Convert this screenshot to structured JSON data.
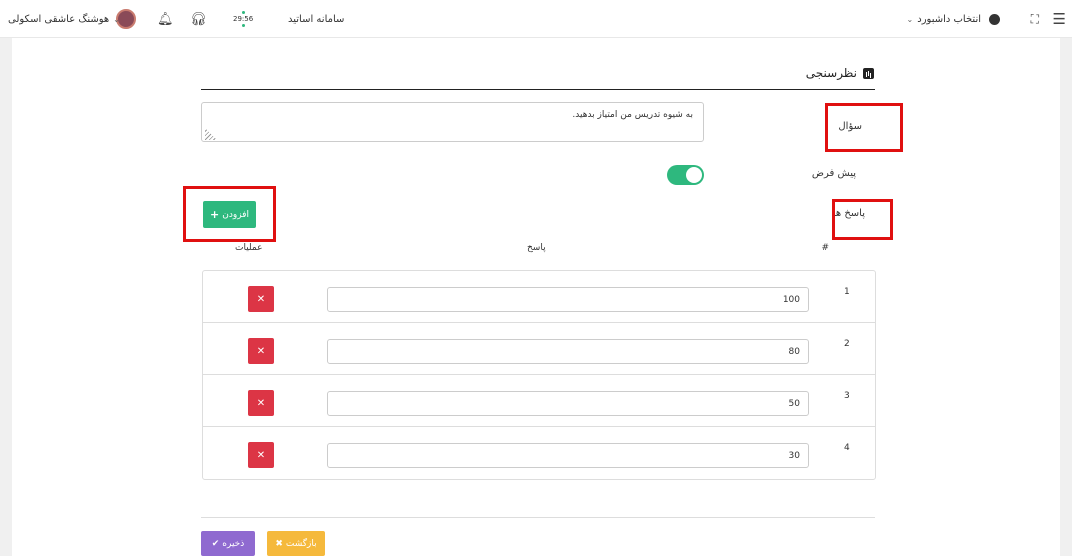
{
  "topbar": {
    "menu_icon": "menu-icon",
    "fullscreen_icon": "fullscreen-icon",
    "dashboard_select": "انتخاب داشبورد",
    "system_title": "سامانه اساتید",
    "clock_time": "29:56",
    "user_name": "هوشنگ عاشقی اسکولی"
  },
  "section": {
    "title": "نظرسنجی"
  },
  "form": {
    "question_label": "سؤال",
    "question_value": "به شیوه تدریس من امتیاز بدهید.",
    "default_label": "پیش فرض",
    "default_on": true,
    "answers_label": "پاسخ ها",
    "add_button": "افزودن"
  },
  "table": {
    "columns": {
      "num": "#",
      "answer": "پاسخ",
      "ops": "عملیات"
    },
    "rows": [
      {
        "index": "1",
        "answer": "100"
      },
      {
        "index": "2",
        "answer": "80"
      },
      {
        "index": "3",
        "answer": "50"
      },
      {
        "index": "4",
        "answer": "30"
      }
    ]
  },
  "footer": {
    "back_button": "بازگشت",
    "save_button": "ذخیره"
  },
  "colors": {
    "green": "#2eb87e",
    "red": "#dc3545",
    "yellow": "#f5b93c",
    "purple": "#8f6ad0",
    "highlight": "#e01010"
  }
}
